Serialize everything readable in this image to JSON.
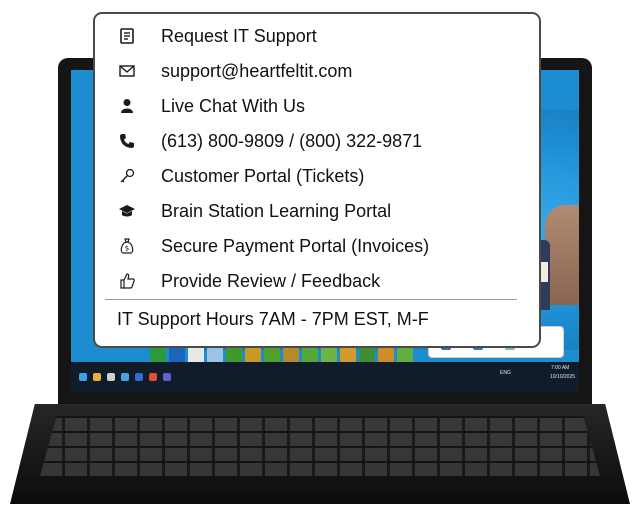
{
  "menu": {
    "items": [
      {
        "icon": "document-icon",
        "label": "Request IT Support"
      },
      {
        "icon": "envelope-icon",
        "label": "support@heartfeltit.com"
      },
      {
        "icon": "person-icon",
        "label": "Live Chat With Us"
      },
      {
        "icon": "phone-icon",
        "label": "(613) 800-9809 / (800) 322-9871"
      },
      {
        "icon": "key-icon",
        "label": "Customer Portal (Tickets)"
      },
      {
        "icon": "graduation-cap-icon",
        "label": "Brain Station Learning Portal"
      },
      {
        "icon": "money-bag-icon",
        "label": "Secure Payment Portal (Invoices)"
      },
      {
        "icon": "thumbs-up-icon",
        "label": "Provide Review / Feedback"
      }
    ],
    "hours": "IT Support Hours 7AM - 7PM EST, M-F"
  },
  "taskbar": {
    "language": "ENG",
    "time": "7:00 AM",
    "date": "10/10/2025"
  },
  "colors": {
    "desktop": "#1d8dd2",
    "heart": "#e0262f",
    "menu_border": "#4a4a4a"
  }
}
